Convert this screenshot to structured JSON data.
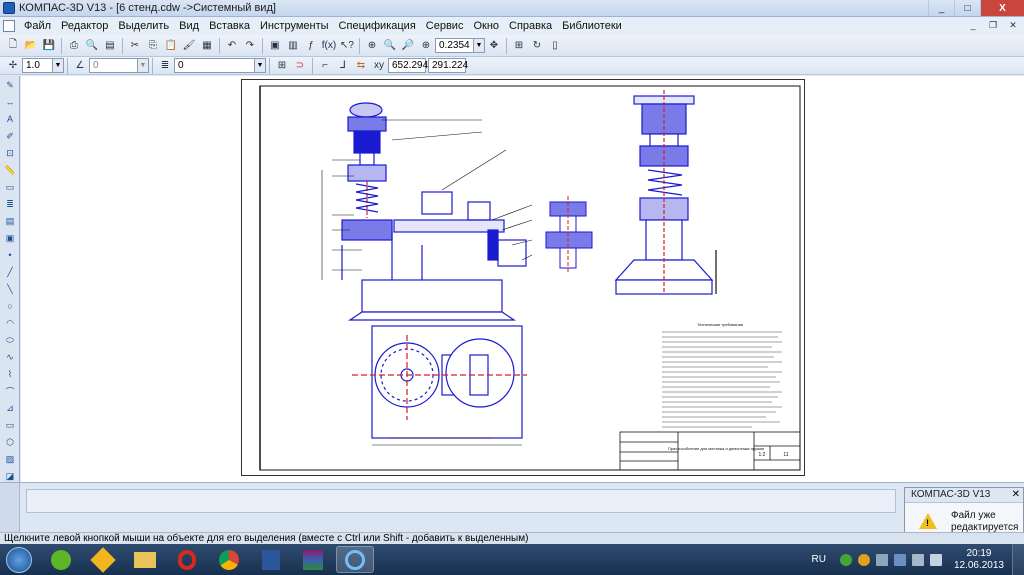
{
  "window": {
    "title": "КОМПАС-3D V13 - [6 стенд.cdw ->Системный вид]",
    "min": "_",
    "max": "□",
    "close": "X"
  },
  "menu": [
    "Файл",
    "Редактор",
    "Выделить",
    "Вид",
    "Вставка",
    "Инструменты",
    "Спецификация",
    "Сервис",
    "Окно",
    "Справка",
    "Библиотеки"
  ],
  "toolbar1": {
    "zoom_value": "0.2354"
  },
  "toolbar2": {
    "step_value": "1.0",
    "angle_value": "0",
    "layer_value": "0",
    "coord_x": "652.294",
    "coord_y": "291.224"
  },
  "drawing": {
    "tech_title": "Технические требования",
    "title_block_name": "Приспособление для монтажа и демонтажа пружин",
    "sheet_scale": "1:2",
    "sheet_number": "11"
  },
  "panel": {},
  "notification": {
    "app": "КОМПАС-3D V13",
    "message_line1": "Файл уже",
    "message_line2": "редактируется"
  },
  "status": {
    "hint": "Щелкните левой кнопкой мыши на объекте для его выделения (вместе с Ctrl или Shift - добавить к выделенным)"
  },
  "taskbar": {
    "language": "RU",
    "time": "20:19",
    "date": "12.06.2013"
  },
  "colors": {
    "drawing_blue": "#1a1ad0",
    "drawing_line": "#111111",
    "axis_red": "#d02020",
    "taskbar": "#1f3a5f"
  }
}
